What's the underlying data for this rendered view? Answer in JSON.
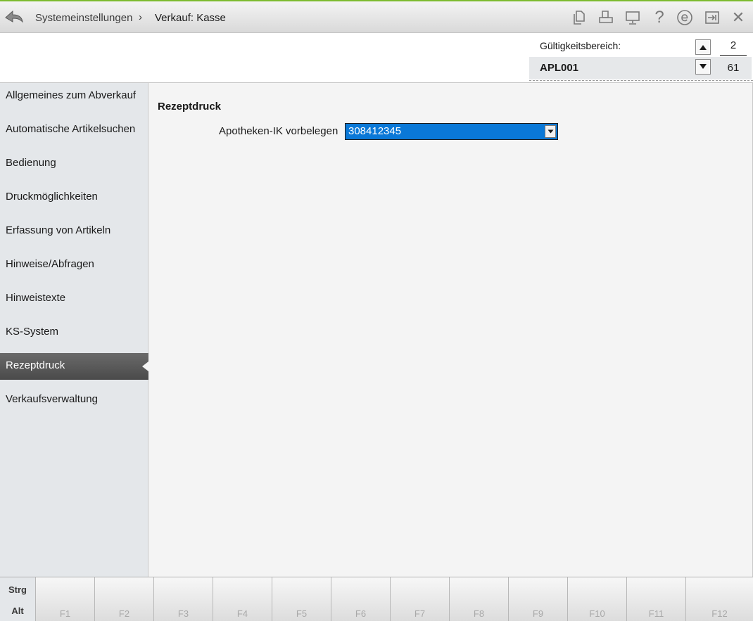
{
  "header": {
    "back_icon": "back-arrow-icon",
    "breadcrumb": [
      "Systemeinstellungen",
      "Verkauf: Kasse"
    ],
    "separator": "›",
    "help_glyph": "?",
    "close_glyph": "✕",
    "icons": [
      "copy-document-icon",
      "print-icon",
      "monitor-icon",
      "help-icon",
      "e-info-icon",
      "exit-icon",
      "close-icon"
    ]
  },
  "scope": {
    "label": "Gültigkeitsbereich:",
    "code": "APL001",
    "value_top": "2",
    "value_bottom": "61"
  },
  "sidebar": {
    "items": [
      {
        "label": "Allgemeines zum Abverkauf",
        "active": false
      },
      {
        "label": "Automatische Artikelsuchen",
        "active": false
      },
      {
        "label": "Bedienung",
        "active": false
      },
      {
        "label": "Druckmöglichkeiten",
        "active": false
      },
      {
        "label": "Erfassung von Artikeln",
        "active": false
      },
      {
        "label": "Hinweise/Abfragen",
        "active": false
      },
      {
        "label": "Hinweistexte",
        "active": false
      },
      {
        "label": "KS-System",
        "active": false
      },
      {
        "label": "Rezeptdruck",
        "active": true
      },
      {
        "label": "Verkaufsverwaltung",
        "active": false
      }
    ]
  },
  "main": {
    "section_title": "Rezeptdruck",
    "field_label": "Apotheken-IK vorbelegen",
    "field_value": "308412345"
  },
  "fkeys": {
    "modifiers": [
      "Strg",
      "Alt"
    ],
    "keys": [
      "F1",
      "F2",
      "F3",
      "F4",
      "F5",
      "F6",
      "F7",
      "F8",
      "F9",
      "F10",
      "F11",
      "F12"
    ]
  },
  "colors": {
    "accent_top": "#7dbb2f",
    "select_bg": "#0a78d7",
    "active_nav": "#555555"
  }
}
